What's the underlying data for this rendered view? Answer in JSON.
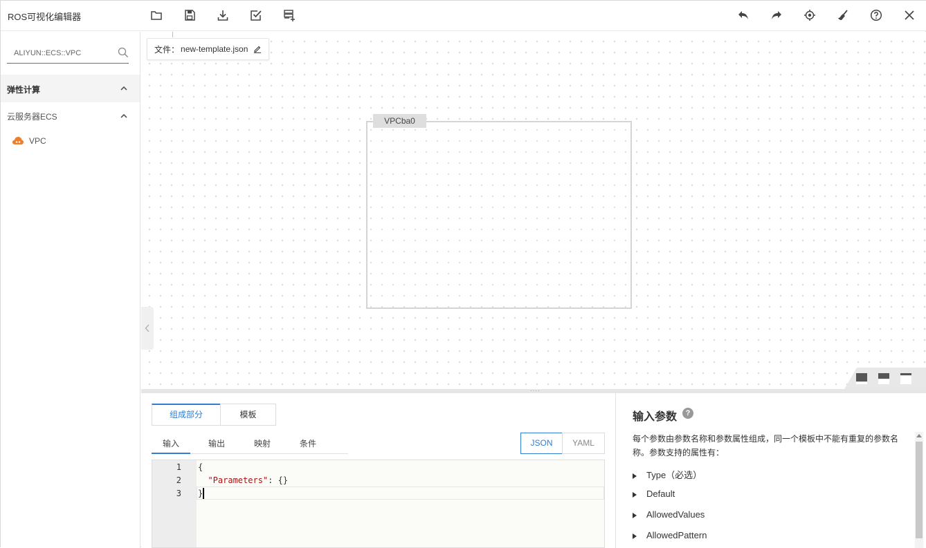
{
  "app": {
    "title": "ROS可视化编辑器",
    "toolbar_left": [
      "folder-icon",
      "save-icon",
      "download-icon",
      "validate-icon",
      "add-template-icon"
    ],
    "toolbar_right": [
      "undo-icon",
      "redo-icon",
      "locate-icon",
      "clear-icon",
      "help-icon",
      "close-icon"
    ]
  },
  "sidebar": {
    "search_value": "ALIYUN::ECS::VPC",
    "categories": [
      {
        "label": "弹性计算",
        "expanded": true
      },
      {
        "label": "云服务器ECS",
        "expanded": true
      }
    ],
    "resources": [
      {
        "label": "VPC",
        "icon": "cloud-icon",
        "icon_color": "#f07d28"
      }
    ]
  },
  "canvas": {
    "file_prefix": "文件：",
    "file_name": "new-template.json",
    "node_label": "VPCba0"
  },
  "editor": {
    "main_tabs": [
      {
        "label": "组成部分",
        "active": true
      },
      {
        "label": "模板",
        "active": false
      }
    ],
    "sub_tabs": [
      {
        "label": "输入",
        "active": true
      },
      {
        "label": "输出",
        "active": false
      },
      {
        "label": "映射",
        "active": false
      },
      {
        "label": "条件",
        "active": false
      }
    ],
    "formats": [
      {
        "label": "JSON",
        "active": true
      },
      {
        "label": "YAML",
        "active": false
      }
    ],
    "lines": [
      {
        "num": "1",
        "text": "{"
      },
      {
        "num": "2",
        "key": "\"Parameters\"",
        "rest": ": {}"
      },
      {
        "num": "3",
        "text": "}"
      }
    ]
  },
  "help": {
    "title": "输入参数",
    "description": "每个参数由参数名称和参数属性组成，同一个模板中不能有重复的参数名称。参数支持的属性有：",
    "properties": [
      "Type（必选）",
      "Default",
      "AllowedValues",
      "AllowedPattern"
    ]
  },
  "colors": {
    "accent": "#2e7dd0",
    "icon": "#555555"
  }
}
